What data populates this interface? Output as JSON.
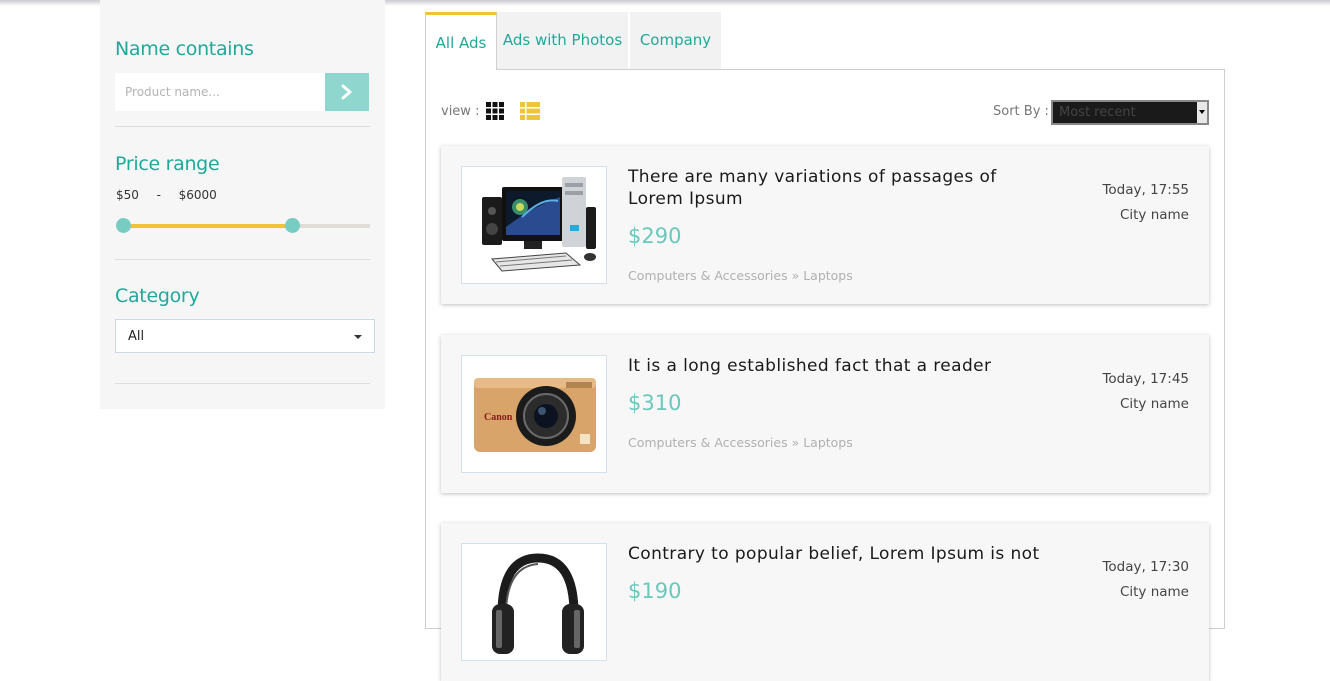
{
  "sidebar": {
    "name_filter": {
      "title": "Name contains",
      "placeholder": "Product name..."
    },
    "price_filter": {
      "title": "Price range",
      "min": "$50",
      "separator": "-",
      "max": "$6000",
      "slider_low_fraction": 0.0,
      "slider_high_fraction": 0.69
    },
    "category_filter": {
      "title": "Category",
      "selected": "All"
    }
  },
  "tabs": [
    {
      "label": "All Ads",
      "active": true
    },
    {
      "label": "Ads with Photos",
      "active": false
    },
    {
      "label": "Company",
      "active": false
    }
  ],
  "toolbar": {
    "view_label": "view :",
    "sort_label": "Sort By :",
    "sort_selected": "Most recent"
  },
  "ads": [
    {
      "title": "There are many variations of passages of Lorem Ipsum",
      "price": "$290",
      "category": "Computers & Accessories » Laptops",
      "time": "Today, 17:55",
      "city": "City name",
      "image_icon": "desktop-computer"
    },
    {
      "title": "It is a long established fact that a reader",
      "price": "$310",
      "category": "Computers & Accessories » Laptops",
      "time": "Today, 17:45",
      "city": "City name",
      "image_icon": "camera"
    },
    {
      "title": "Contrary to popular belief, Lorem Ipsum is not",
      "price": "$190",
      "category": "",
      "time": "Today, 17:30",
      "city": "City name",
      "image_icon": "headphones"
    }
  ],
  "colors": {
    "accent": "#1fa99a",
    "highlight": "#f0c43a",
    "price": "#6cc7bd",
    "button": "#8ed6ce"
  }
}
